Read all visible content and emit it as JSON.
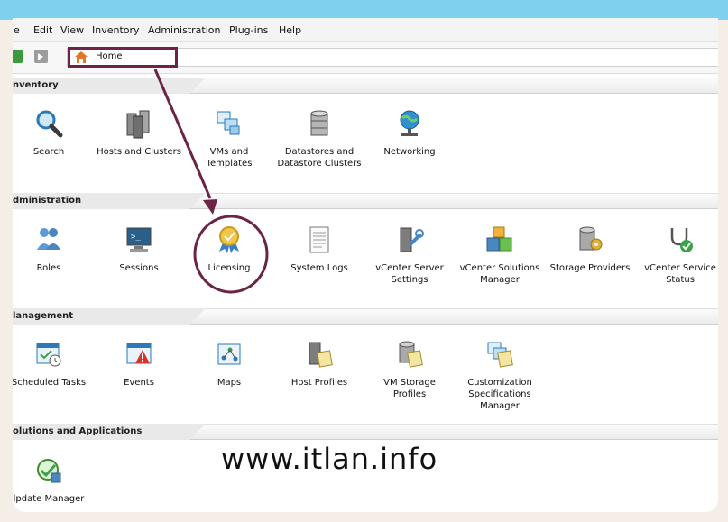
{
  "menu": [
    "le",
    "Edit",
    "View",
    "Inventory",
    "Administration",
    "Plug-ins",
    "Help"
  ],
  "address": {
    "label": "Home"
  },
  "sections": {
    "inventory": {
      "title": "nventory",
      "items": [
        {
          "label": "Search",
          "icon": "search-icon"
        },
        {
          "label": "Hosts and Clusters",
          "icon": "hosts-clusters-icon"
        },
        {
          "label": "VMs and\nTemplates",
          "icon": "vms-templates-icon"
        },
        {
          "label": "Datastores and\nDatastore Clusters",
          "icon": "datastores-icon"
        },
        {
          "label": "Networking",
          "icon": "networking-icon"
        }
      ]
    },
    "administration": {
      "title": "dministration",
      "items": [
        {
          "label": "Roles",
          "icon": "roles-icon"
        },
        {
          "label": "Sessions",
          "icon": "sessions-icon"
        },
        {
          "label": "Licensing",
          "icon": "licensing-icon"
        },
        {
          "label": "System Logs",
          "icon": "system-logs-icon"
        },
        {
          "label": "vCenter Server\nSettings",
          "icon": "vcenter-settings-icon"
        },
        {
          "label": "vCenter Solutions\nManager",
          "icon": "solutions-manager-icon"
        },
        {
          "label": "Storage Providers",
          "icon": "storage-providers-icon"
        },
        {
          "label": "vCenter Service\nStatus",
          "icon": "service-status-icon"
        }
      ]
    },
    "management": {
      "title": "lanagement",
      "items": [
        {
          "label": "Scheduled Tasks",
          "icon": "scheduled-tasks-icon"
        },
        {
          "label": "Events",
          "icon": "events-icon"
        },
        {
          "label": "Maps",
          "icon": "maps-icon"
        },
        {
          "label": "Host Profiles",
          "icon": "host-profiles-icon"
        },
        {
          "label": "VM Storage\nProfiles",
          "icon": "vm-storage-profiles-icon"
        },
        {
          "label": "Customization\nSpecifications\nManager",
          "icon": "customization-specs-icon"
        }
      ]
    },
    "solutions": {
      "title": "olutions and Applications",
      "items": [
        {
          "label": "lpdate Manager",
          "icon": "update-manager-icon"
        }
      ]
    }
  },
  "watermark": "www.itlan.info",
  "colors": {
    "accent": "#6b2445",
    "topbar": "#7fd0ee"
  }
}
